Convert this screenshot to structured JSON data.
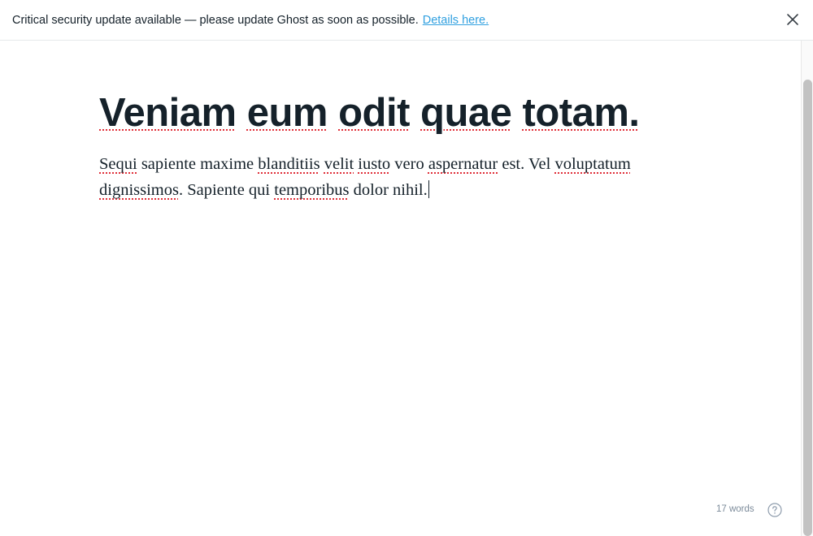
{
  "banner": {
    "message": "Critical security update available — please update Ghost as soon as possible.",
    "link_text": "Details here.",
    "close_icon": "close-icon"
  },
  "post": {
    "title_words": [
      "Veniam",
      "eum",
      "odit",
      "quae",
      "totam."
    ],
    "body_line1": [
      {
        "t": "Sequi",
        "sp": true
      },
      {
        "t": " sapiente maxime ",
        "sp": false
      },
      {
        "t": "blanditiis",
        "sp": true
      },
      {
        "t": " ",
        "sp": false
      },
      {
        "t": "velit",
        "sp": true
      },
      {
        "t": " ",
        "sp": false
      },
      {
        "t": "iusto",
        "sp": true
      },
      {
        "t": " vero ",
        "sp": false
      },
      {
        "t": "aspernatur",
        "sp": true
      },
      {
        "t": " est. Vel ",
        "sp": false
      },
      {
        "t": "voluptatum",
        "sp": true
      }
    ],
    "body_line2": [
      {
        "t": "dignissimos",
        "sp": true
      },
      {
        "t": ". Sapiente qui ",
        "sp": false
      },
      {
        "t": "temporibus",
        "sp": true
      },
      {
        "t": " dolor nihil.",
        "sp": false
      }
    ]
  },
  "footer": {
    "word_count": "17 words",
    "help_icon": "help-icon"
  },
  "colors": {
    "link": "#30a0e0",
    "spellcheck": "#e0303a",
    "text": "#15212a",
    "muted": "#7c8b9a"
  }
}
